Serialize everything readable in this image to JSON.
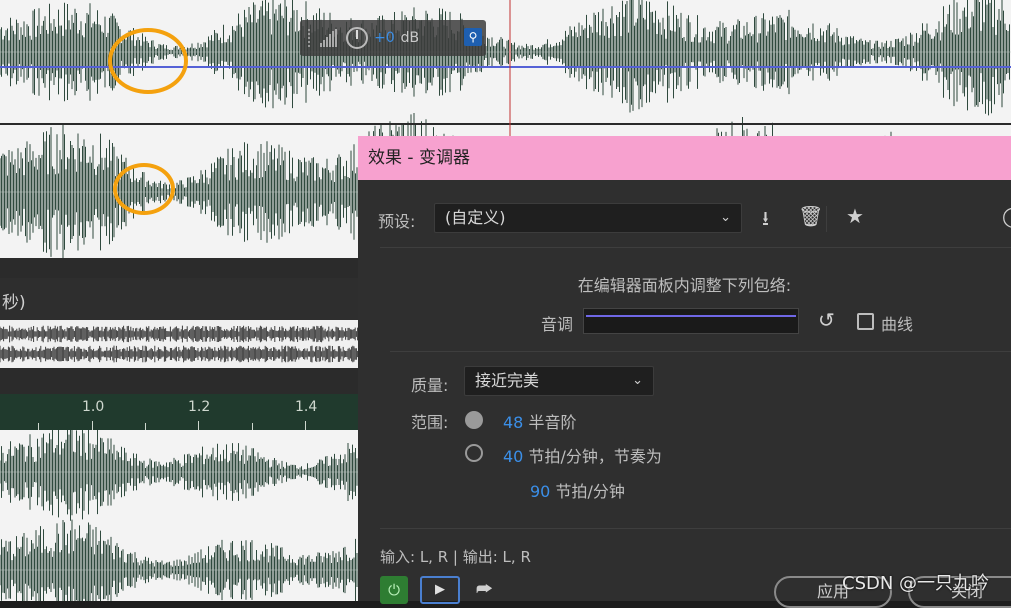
{
  "meter_hud": {
    "gain_value": "+0",
    "gain_unit": "dB"
  },
  "timeline": {
    "unit_label": "秒)",
    "ruler_ticks": [
      "1.0",
      "1.2",
      "1.4"
    ]
  },
  "dialog": {
    "title": "效果 - 变调器",
    "preset": {
      "label": "预设:",
      "value": "(自定义)"
    },
    "hint": "在编辑器面板内调整下列包络:",
    "pitch": {
      "label": "音调",
      "curve_label": "曲线",
      "curve_checked": false,
      "line_color": "#6f67e6"
    },
    "quality": {
      "label": "质量:",
      "value": "接近完美"
    },
    "range": {
      "label": "范围:",
      "option1_value": "48",
      "option1_unit": "半音阶",
      "option1_selected": true,
      "option2_value": "40",
      "option2_unit": "节拍/分钟，节奏为",
      "option2_selected": false,
      "option3_value": "90",
      "option3_unit": "节拍/分钟"
    },
    "io": "输入: L, R | 输出: L, R",
    "apply_label": "应用",
    "close_label": "关闭"
  },
  "watermark": "CSDN @一只九吟",
  "colors": {
    "title_bar": "#f7a1cf",
    "accent_blue": "#3b8fe8",
    "waveform": "#2f4a3e",
    "annotation": "#f4a10e"
  }
}
